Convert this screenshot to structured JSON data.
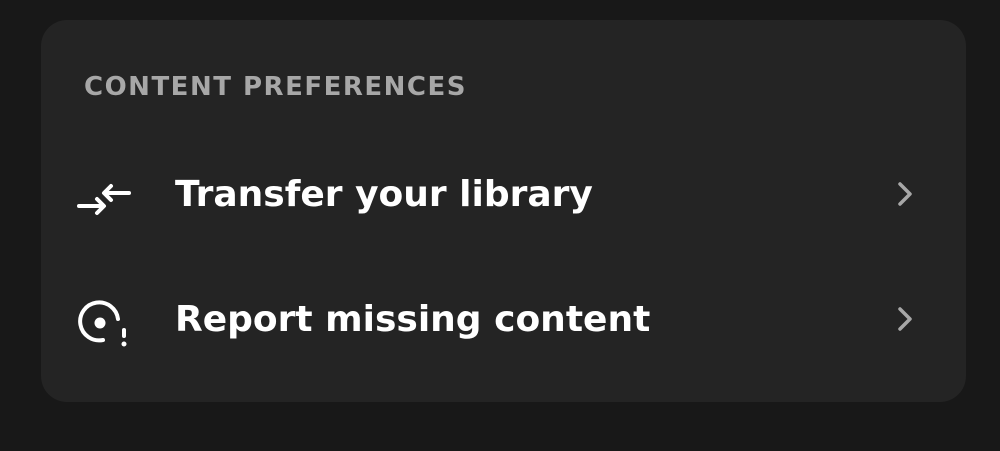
{
  "section": {
    "title": "CONTENT PREFERENCES"
  },
  "items": [
    {
      "label": "Transfer your library",
      "icon": "transfer-arrows-icon"
    },
    {
      "label": "Report missing content",
      "icon": "report-missing-content-icon"
    }
  ],
  "colors": {
    "background": "#181818",
    "card": "#242424",
    "title": "#a7a7a7",
    "label": "#ffffff",
    "chevron": "#a7a7a7"
  }
}
